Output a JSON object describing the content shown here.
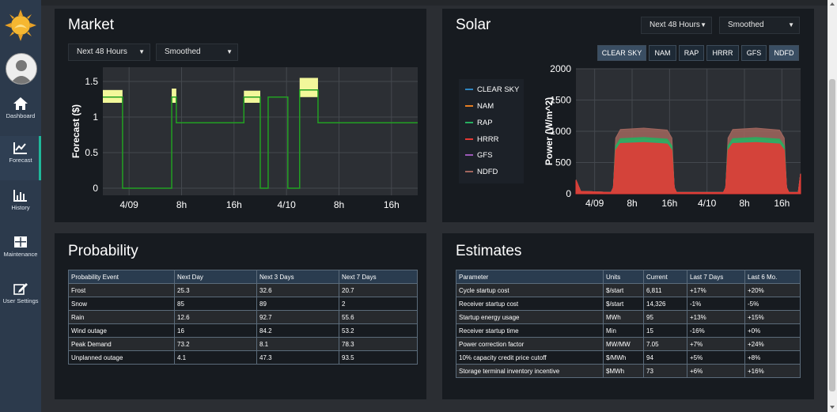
{
  "nav": [
    {
      "label": "Dashboard",
      "icon": "home-icon"
    },
    {
      "label": "Forecast",
      "icon": "chart-line-icon",
      "active": true
    },
    {
      "label": "History",
      "icon": "bar-chart-icon"
    },
    {
      "label": "Maintenance",
      "icon": "grid-icon"
    },
    {
      "label": "User Settings",
      "icon": "edit-icon"
    }
  ],
  "market": {
    "title": "Market",
    "horizon": "Next 48 Hours",
    "mode": "Smoothed"
  },
  "solar": {
    "title": "Solar",
    "horizon": "Next 48 Hours",
    "mode": "Smoothed",
    "models": [
      "CLEAR SKY",
      "NAM",
      "RAP",
      "HRRR",
      "GFS",
      "NDFD"
    ],
    "active_models": [
      "CLEAR SKY",
      "NDFD"
    ]
  },
  "probability": {
    "title": "Probability",
    "columns": [
      "Probability Event",
      "Next Day",
      "Next 3 Days",
      "Next 7 Days"
    ],
    "rows": [
      [
        "Frost",
        "25.3",
        "32.6",
        "20.7"
      ],
      [
        "Snow",
        "85",
        "89",
        "2"
      ],
      [
        "Rain",
        "12.6",
        "92.7",
        "55.6"
      ],
      [
        "Wind outage",
        "16",
        "84.2",
        "53.2"
      ],
      [
        "Peak Demand",
        "73.2",
        "8.1",
        "78.3"
      ],
      [
        "Unplanned outage",
        "4.1",
        "47.3",
        "93.5"
      ]
    ]
  },
  "estimates": {
    "title": "Estimates",
    "columns": [
      "Parameter",
      "Units",
      "Current",
      "Last 7 Days",
      "Last 6 Mo."
    ],
    "rows": [
      [
        "Cycle startup cost",
        "$/start",
        "6,811",
        "+17%",
        "+20%"
      ],
      [
        "Receiver startup cost",
        "$/start",
        "14,326",
        "-1%",
        "-5%"
      ],
      [
        "Startup energy usage",
        "MWh",
        "95",
        "+13%",
        "+15%"
      ],
      [
        "Receiver startup time",
        "Min",
        "15",
        "-16%",
        "+0%"
      ],
      [
        "Power correction factor",
        "MW/MW",
        "7.05",
        "+7%",
        "+24%"
      ],
      [
        "10% capacity credit price cutoff",
        "$/MWh",
        "94",
        "+5%",
        "+8%"
      ],
      [
        "Storage terminal inventory incentive",
        "$MWh",
        "73",
        "+6%",
        "+16%"
      ]
    ]
  },
  "chart_data": [
    {
      "type": "line",
      "ylabel": "Forecast ($)",
      "xlabel": "",
      "x_ticks": [
        "4/09",
        "8h",
        "16h",
        "4/10",
        "8h",
        "16h"
      ],
      "x_range_hours": [
        0,
        48
      ],
      "x_tick_hours": [
        4,
        12,
        20,
        28,
        36,
        44
      ],
      "y_ticks": [
        0,
        0.5,
        1,
        1.5
      ],
      "ylim": [
        -0.1,
        1.7
      ],
      "grid": true,
      "series": [
        {
          "color": "#22a022",
          "x": [
            0,
            3,
            3.01,
            10.5,
            10.5,
            11.2,
            11.2,
            21.5,
            21.5,
            24,
            24,
            25.2,
            25.2,
            28.2,
            28.2,
            30,
            30,
            32.8,
            32.8,
            48
          ],
          "y": [
            1.28,
            1.28,
            0,
            0,
            1.28,
            1.28,
            0.92,
            0.92,
            1.28,
            1.28,
            0,
            0,
            1.28,
            1.28,
            0,
            0,
            1.38,
            1.38,
            0.92,
            0.92
          ]
        }
      ],
      "bands": [
        {
          "color": "#f2f79a",
          "x": [
            0,
            3
          ],
          "low": 1.2,
          "high": 1.38
        },
        {
          "color": "#f2f79a",
          "x": [
            10.5,
            11.2
          ],
          "low": 1.2,
          "high": 1.4
        },
        {
          "color": "#f2f79a",
          "x": [
            21.5,
            24
          ],
          "low": 1.2,
          "high": 1.37
        },
        {
          "color": "#f2f79a",
          "x": [
            30,
            32.8
          ],
          "low": 1.28,
          "high": 1.55
        }
      ]
    },
    {
      "type": "area",
      "ylabel": "Power (W/m^2)",
      "xlabel": "",
      "x_ticks": [
        "4/09",
        "8h",
        "16h",
        "4/10",
        "8h",
        "16h"
      ],
      "x_range_hours": [
        0,
        48
      ],
      "x_tick_hours": [
        4,
        12,
        20,
        28,
        36,
        44
      ],
      "y_ticks": [
        0,
        500,
        1000,
        1500,
        2000
      ],
      "ylim": [
        0,
        2000
      ],
      "grid": true,
      "legend": "left",
      "series": [
        {
          "name": "CLEAR SKY",
          "color": "#2e86c1",
          "peak": 860
        },
        {
          "name": "NAM",
          "color": "#e67e22",
          "peak": 870
        },
        {
          "name": "RAP",
          "color": "#27ae60",
          "peak": 900
        },
        {
          "name": "HRRR",
          "color": "#e53935",
          "peak": 820
        },
        {
          "name": "GFS",
          "color": "#9b59b6",
          "peak": 850
        },
        {
          "name": "NDFD",
          "color": "#a1665e",
          "peak": 1050
        }
      ],
      "day_windows_hours": [
        [
          8,
          21
        ],
        [
          32,
          45
        ]
      ]
    }
  ]
}
